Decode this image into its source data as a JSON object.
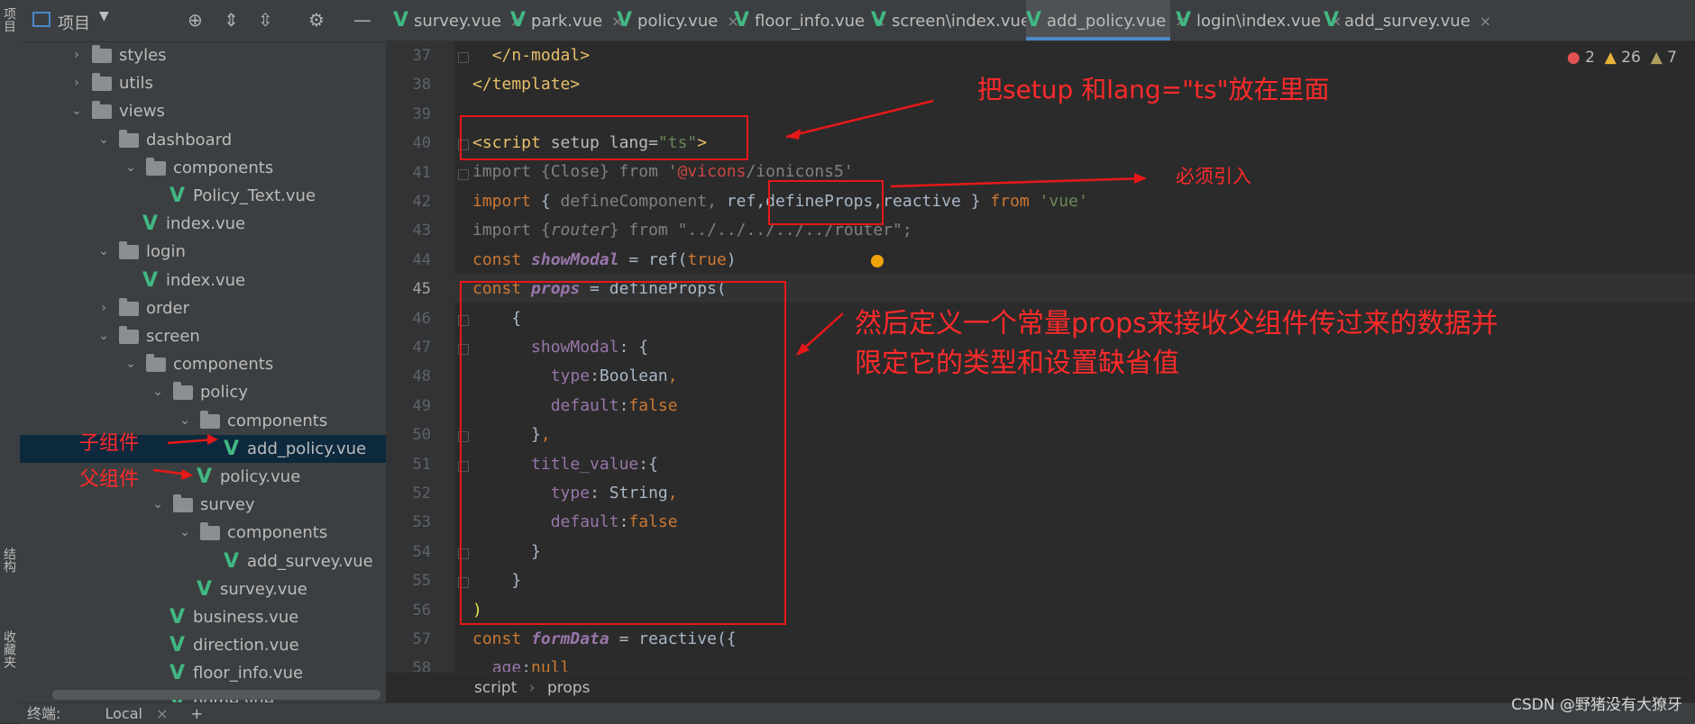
{
  "sidebar": {
    "top_label": "项目",
    "mid_label": "结构",
    "bottom_label": "收藏夹"
  },
  "project": {
    "title": "项目"
  },
  "tree": [
    {
      "label": "styles",
      "kind": "folder",
      "indent": 1,
      "open": false
    },
    {
      "label": "utils",
      "kind": "folder",
      "indent": 1,
      "open": false
    },
    {
      "label": "views",
      "kind": "folder",
      "indent": 1,
      "open": true
    },
    {
      "label": "dashboard",
      "kind": "folder",
      "indent": 2,
      "open": true
    },
    {
      "label": "components",
      "kind": "folder",
      "indent": 3,
      "open": true
    },
    {
      "label": "Policy_Text.vue",
      "kind": "vue",
      "indent": 4
    },
    {
      "label": "index.vue",
      "kind": "vue",
      "indent": 3
    },
    {
      "label": "login",
      "kind": "folder",
      "indent": 2,
      "open": true
    },
    {
      "label": "index.vue",
      "kind": "vue",
      "indent": 3
    },
    {
      "label": "order",
      "kind": "folder",
      "indent": 2,
      "open": false
    },
    {
      "label": "screen",
      "kind": "folder",
      "indent": 2,
      "open": true
    },
    {
      "label": "components",
      "kind": "folder",
      "indent": 3,
      "open": true
    },
    {
      "label": "policy",
      "kind": "folder",
      "indent": 4,
      "open": true
    },
    {
      "label": "components",
      "kind": "folder",
      "indent": 5,
      "open": true
    },
    {
      "label": "add_policy.vue",
      "kind": "vue",
      "indent": 6,
      "selected": true
    },
    {
      "label": "policy.vue",
      "kind": "vue",
      "indent": 5
    },
    {
      "label": "survey",
      "kind": "folder",
      "indent": 4,
      "open": true
    },
    {
      "label": "components",
      "kind": "folder",
      "indent": 5,
      "open": true
    },
    {
      "label": "add_survey.vue",
      "kind": "vue",
      "indent": 6
    },
    {
      "label": "survey.vue",
      "kind": "vue",
      "indent": 5
    },
    {
      "label": "business.vue",
      "kind": "vue",
      "indent": 4
    },
    {
      "label": "direction.vue",
      "kind": "vue",
      "indent": 4
    },
    {
      "label": "floor_info.vue",
      "kind": "vue",
      "indent": 4
    },
    {
      "label": "home.vue",
      "kind": "vue",
      "indent": 4
    }
  ],
  "tabs": [
    {
      "label": "survey.vue"
    },
    {
      "label": "park.vue"
    },
    {
      "label": "policy.vue"
    },
    {
      "label": "floor_info.vue"
    },
    {
      "label": "screen\\index.vue"
    },
    {
      "label": "add_policy.vue",
      "active": true
    },
    {
      "label": "login\\index.vue"
    },
    {
      "label": "add_survey.vue"
    }
  ],
  "problems": {
    "errors": "2",
    "warnings": "26",
    "weak": "7"
  },
  "line_numbers": [
    "37",
    "38",
    "39",
    "40",
    "41",
    "42",
    "43",
    "44",
    "45",
    "46",
    "47",
    "48",
    "49",
    "50",
    "51",
    "52",
    "53",
    "54",
    "55",
    "56",
    "57",
    "58"
  ],
  "breadcrumb": {
    "a": "script",
    "b": "props"
  },
  "bottom_bar": {
    "terminal": "终端:",
    "local": "Local",
    "plus": "+"
  },
  "annotations": {
    "setup_note": "把setup 和lang=\"ts\"放在里面",
    "must_import": "必须引入",
    "props_note_1": "然后定义一个常量props来接收父组件传过来的数据并",
    "props_note_2": "限定它的类型和设置缺省值",
    "child_label": "子组件",
    "parent_label": "父组件"
  },
  "watermark": "CSDN @野猪没有大獠牙",
  "colors": {
    "accent": "#4a88c7",
    "vue_green": "#41b883",
    "annotation_red": "#e81818"
  }
}
